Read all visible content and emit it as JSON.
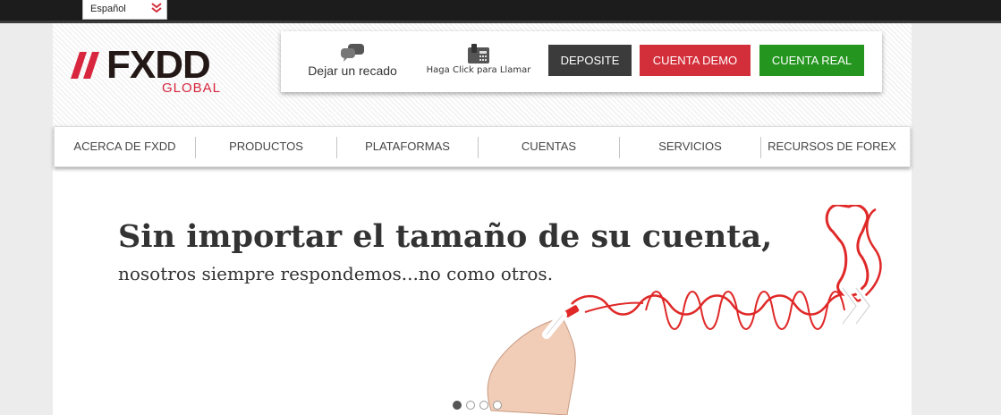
{
  "language": {
    "selected": "Español",
    "icon": "double-chevron-down-icon",
    "icon_color": "#d32f3a"
  },
  "logo": {
    "text": "FXDD",
    "subtitle": "GLOBAL",
    "brand_color": "#d7263d"
  },
  "contact": {
    "message_label": "Dejar un recado",
    "message_icon": "chat-bubbles-icon",
    "call_label": "Haga Click para Llamar",
    "call_icon": "desk-phone-icon"
  },
  "buttons": {
    "deposit": "DEPOSITE",
    "demo": "CUENTA DEMO",
    "real": "CUENTA REAL"
  },
  "button_colors": {
    "deposit": "#3b3b3b",
    "demo": "#d32f3a",
    "real": "#24961f"
  },
  "nav": {
    "items": [
      {
        "label": "ACERCA DE FXDD"
      },
      {
        "label": "PRODUCTOS"
      },
      {
        "label": "PLATAFORMAS"
      },
      {
        "label": "CUENTAS"
      },
      {
        "label": "SERVICIOS"
      },
      {
        "label": "RECURSOS DE FOREX"
      }
    ]
  },
  "slide": {
    "headline": "Sin importar el tamaño de su cuenta,",
    "subline": "nosotros siempre respondemos...no como otros.",
    "illustration": "hand-drawing-phone-cord",
    "next_icon": "double-chevron-right-icon"
  },
  "carousel": {
    "total_slides": 4,
    "active_slide": 1
  }
}
